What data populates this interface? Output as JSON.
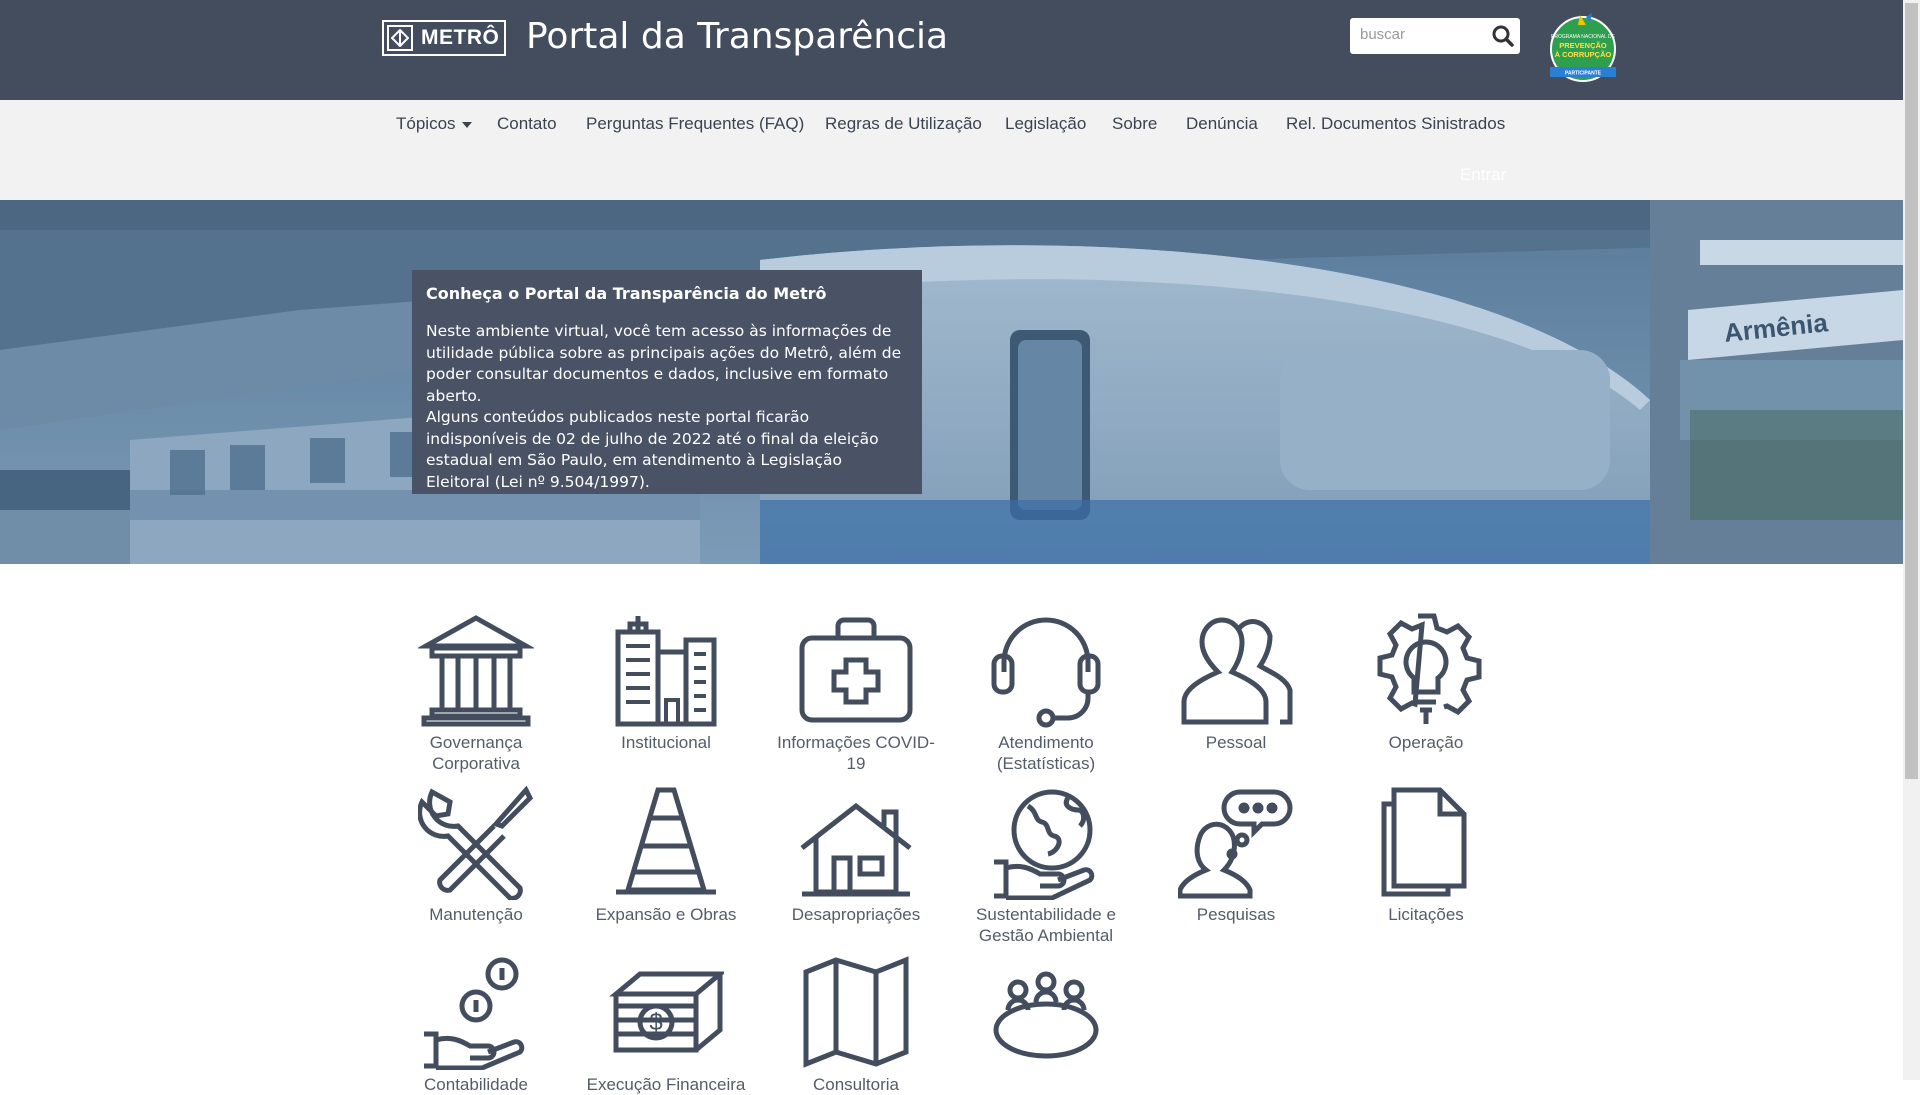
{
  "header": {
    "logo_text": "METRÔ",
    "title": "Portal da Transparência",
    "search_placeholder": "buscar",
    "badge_lines": [
      "PROGRAMA NACIONAL DE",
      "PREVENÇÃO",
      "À CORRUPÇÃO",
      "PARTICIPANTE"
    ]
  },
  "nav": {
    "items": [
      "Tópicos",
      "Contato",
      "Perguntas Frequentes (FAQ)",
      "Regras de Utilização",
      "Legislação",
      "Sobre",
      "Denúncia",
      "Rel. Documentos Sinistrados"
    ],
    "login": "Entrar"
  },
  "hero": {
    "station_sign": "Armênia",
    "title": "Conheça o Portal da Transparência do Metrô",
    "paragraph1": "Neste ambiente virtual, você tem acesso às informações de utilidade pública sobre as principais ações do Metrô, além de poder consultar documentos e dados, inclusive em formato aberto.",
    "paragraph2": "Alguns conteúdos publicados neste portal ficarão indisponíveis de 02 de julho de 2022 até o final da eleição estadual em São Paulo, em atendimento à Legislação Eleitoral (Lei nº 9.504/1997)."
  },
  "topics": [
    {
      "label": "Governança Corporativa",
      "icon": "bank-icon"
    },
    {
      "label": "Institucional",
      "icon": "buildings-icon"
    },
    {
      "label": "Informações COVID-19",
      "icon": "medical-kit-icon"
    },
    {
      "label": "Atendimento (Estatísticas)",
      "icon": "headset-icon"
    },
    {
      "label": "Pessoal",
      "icon": "people-icon"
    },
    {
      "label": "Operação",
      "icon": "gear-bulb-icon"
    },
    {
      "label": "Manutenção",
      "icon": "tools-icon"
    },
    {
      "label": "Expansão e Obras",
      "icon": "traffic-cone-icon"
    },
    {
      "label": "Desapropriações",
      "icon": "house-icon"
    },
    {
      "label": "Sustentabilidade e Gestão Ambiental",
      "icon": "globe-hand-icon"
    },
    {
      "label": "Pesquisas",
      "icon": "person-thought-icon"
    },
    {
      "label": "Licitações",
      "icon": "documents-icon"
    },
    {
      "label": "Contabilidade",
      "icon": "coin-hand-icon"
    },
    {
      "label": "Execução Financeira",
      "icon": "money-stack-icon"
    },
    {
      "label": "Consultoria",
      "icon": "map-icon"
    },
    {
      "label": "",
      "icon": "meeting-table-icon"
    }
  ]
}
